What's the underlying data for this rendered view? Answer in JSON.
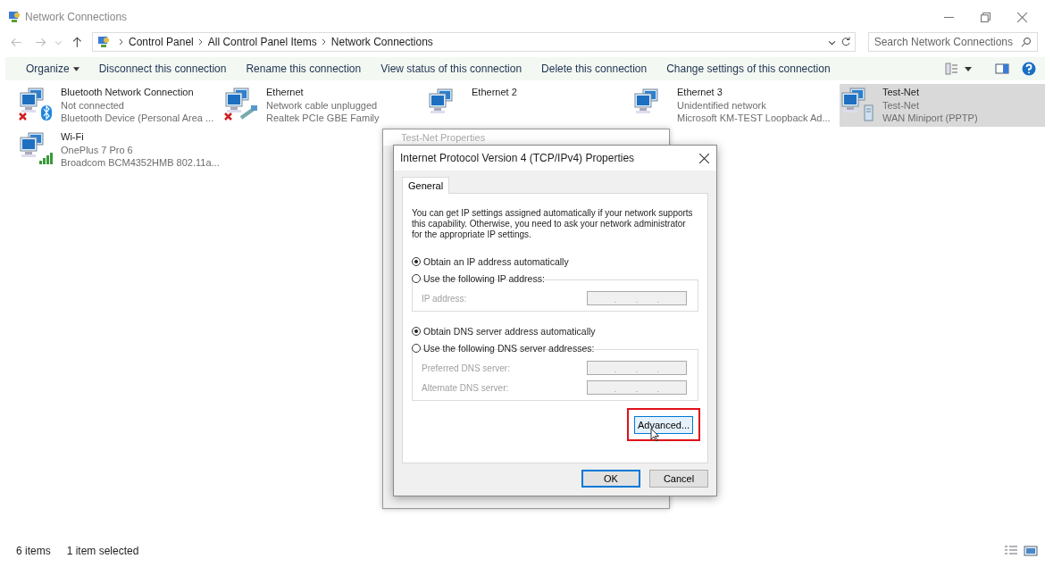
{
  "window": {
    "title": "Network Connections"
  },
  "address_bar": {
    "breadcrumbs": [
      "Control Panel",
      "All Control Panel Items",
      "Network Connections"
    ]
  },
  "search": {
    "placeholder": "Search Network Connections"
  },
  "toolbar": {
    "organize": "Organize",
    "commands": [
      "Disconnect this connection",
      "Rename this connection",
      "View status of this connection",
      "Delete this connection",
      "Change settings of this connection"
    ]
  },
  "connections": [
    {
      "name": "Bluetooth Network Connection",
      "status": "Not connected",
      "device": "Bluetooth Device (Personal Area ...",
      "kind": "bluetooth",
      "error": true,
      "selected": false
    },
    {
      "name": "Ethernet",
      "status": "Network cable unplugged",
      "device": "Realtek PCIe GBE Family",
      "kind": "cable",
      "error": true,
      "selected": false
    },
    {
      "name": "Ethernet 2",
      "kind": "plain",
      "error": false,
      "selected": false
    },
    {
      "name": "Ethernet 3",
      "status": "Unidentified network",
      "device": "Microsoft KM-TEST Loopback Ad...",
      "kind": "plain",
      "error": false,
      "selected": false
    },
    {
      "name": "Test-Net",
      "status": "Test-Net",
      "device": "WAN Miniport (PPTP)",
      "kind": "server",
      "error": false,
      "selected": true
    },
    {
      "name": "Wi-Fi",
      "status": "OnePlus 7 Pro 6",
      "device": "Broadcom BCM4352HMB 802.11a...",
      "kind": "wifi",
      "error": false,
      "selected": false
    }
  ],
  "background_window": {
    "title": "Test-Net Properties"
  },
  "dialog": {
    "title": "Internet Protocol Version 4 (TCP/IPv4) Properties",
    "tabs": [
      {
        "label": "General",
        "selected": true
      }
    ],
    "description": "You can get IP settings assigned automatically if your network supports this capability. Otherwise, you need to ask your network administrator for the appropriate IP settings.",
    "ip_options": [
      {
        "label": "Obtain an IP address automatically",
        "selected": true
      },
      {
        "label": "Use the following IP address:",
        "selected": false
      }
    ],
    "ip_fields": [
      {
        "label": "IP address:",
        "separators": [
          ".",
          ".",
          "."
        ],
        "disabled": true
      }
    ],
    "dns_options": [
      {
        "label": "Obtain DNS server address automatically",
        "selected": true
      },
      {
        "label": "Use the following DNS server addresses:",
        "selected": false
      }
    ],
    "dns_fields": [
      {
        "label": "Preferred DNS server:",
        "separators": [
          ".",
          ".",
          "."
        ],
        "disabled": true
      },
      {
        "label": "Alternate DNS server:",
        "separators": [
          ".",
          ".",
          "."
        ],
        "disabled": true
      }
    ],
    "advanced_button": {
      "label": "Advanced...",
      "highlighted": true
    },
    "buttons": [
      {
        "label": "OK",
        "default": true
      },
      {
        "label": "Cancel",
        "default": false
      }
    ]
  },
  "status_bar": {
    "count": "6 items",
    "selection": "1 item selected"
  }
}
